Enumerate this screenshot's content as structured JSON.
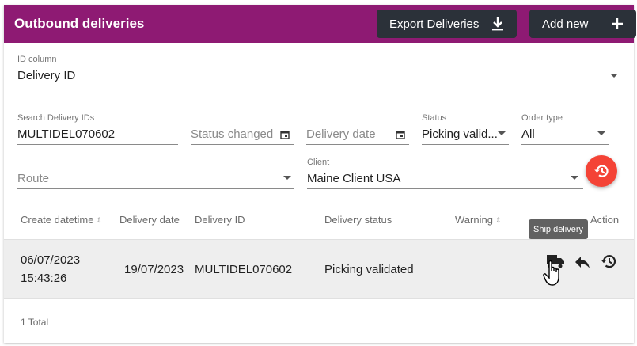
{
  "header": {
    "title": "Outbound deliveries",
    "export_label": "Export Deliveries",
    "add_label": "Add new"
  },
  "filters": {
    "id_column": {
      "label": "ID column",
      "value": "Delivery ID"
    },
    "search": {
      "label": "Search Delivery IDs",
      "value": "MULTIDEL070602"
    },
    "status_changed": {
      "placeholder": "Status changed"
    },
    "delivery_date": {
      "placeholder": "Delivery date"
    },
    "status": {
      "label": "Status",
      "value": "Picking valid..."
    },
    "order_type": {
      "label": "Order type",
      "value": "All"
    },
    "route": {
      "placeholder": "Route"
    },
    "client": {
      "label": "Client",
      "value": "Maine Client USA"
    }
  },
  "table": {
    "columns": [
      "Create datetime",
      "Delivery date",
      "Delivery ID",
      "Delivery status",
      "Warning",
      "Action"
    ],
    "rows": [
      {
        "create_date": "06/07/2023",
        "create_time": "15:43:26",
        "delivery_date": "19/07/2023",
        "delivery_id": "MULTIDEL070602",
        "status": "Picking validated",
        "warning": ""
      }
    ],
    "tooltip": "Ship delivery",
    "total": "1 Total"
  },
  "colors": {
    "header": "#8e1a73",
    "button": "#2b3139",
    "reset": "#f44336"
  },
  "icons": [
    "download-icon",
    "plus-icon",
    "calendar-icon",
    "history-icon",
    "truck-icon",
    "reply-icon",
    "hand-cursor-icon"
  ]
}
